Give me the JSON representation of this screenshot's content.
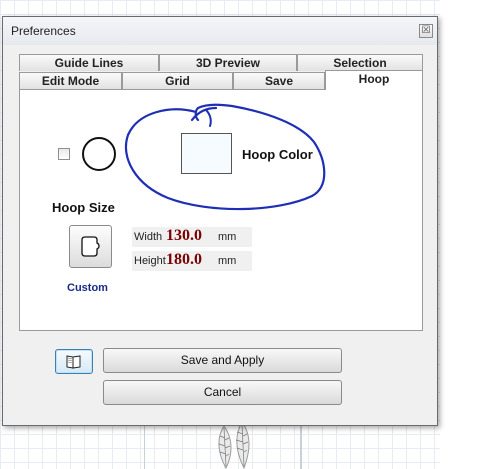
{
  "dialog": {
    "title": "Preferences",
    "close_glyph": "☒"
  },
  "tabs": {
    "row1": [
      "Guide Lines",
      "3D Preview",
      "Selection"
    ],
    "row2": [
      "Edit Mode",
      "Grid",
      "Save",
      "Hoop"
    ],
    "active": "Hoop"
  },
  "hoop": {
    "enabled": false,
    "color_label": "Hoop Color",
    "color_value": "#f6fbff",
    "size_label": "Hoop Size",
    "custom_label": "Custom",
    "width_label": "Width",
    "width_value": "130.0",
    "height_label": "Height",
    "height_value": "180.0",
    "unit": "mm"
  },
  "buttons": {
    "help_icon": "book-icon",
    "save_apply": "Save and Apply",
    "cancel": "Cancel"
  },
  "colors": {
    "annotation": "#1f2fb5",
    "dimension_value": "#7a0000",
    "custom_label": "#1a2a88"
  }
}
